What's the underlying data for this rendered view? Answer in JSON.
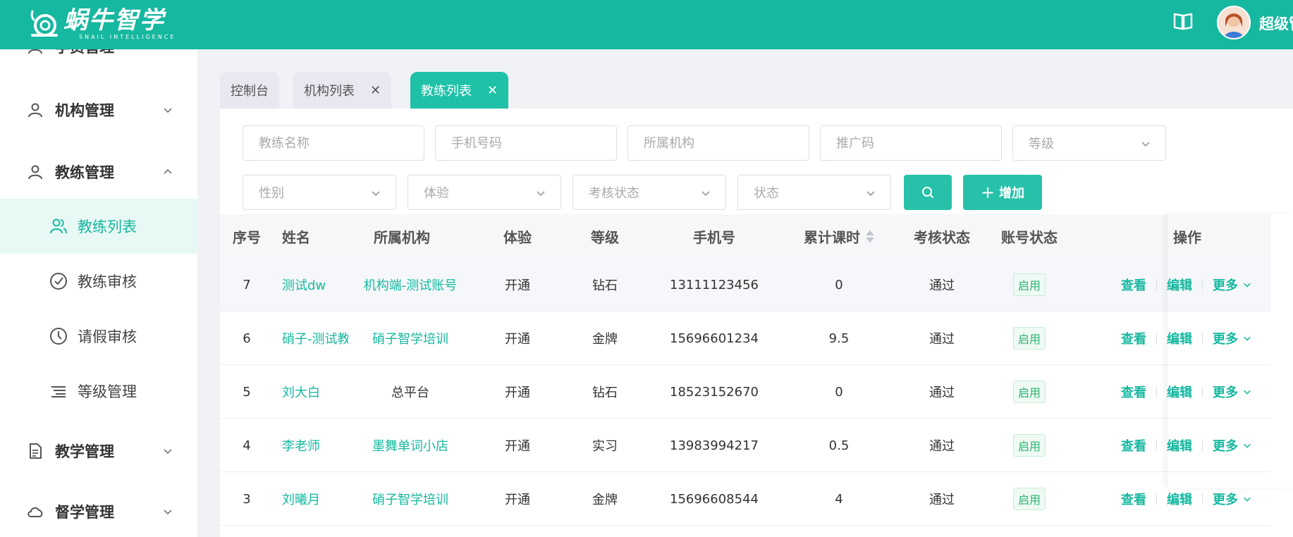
{
  "header": {
    "logo_cn": "蜗牛智学",
    "logo_en": "SNAIL INTELLIGENCE",
    "user_name": "超级管理员"
  },
  "sidebar": {
    "items": [
      {
        "label": "学员管理",
        "icon": "user-icon"
      },
      {
        "label": "机构管理",
        "icon": "user-icon"
      },
      {
        "label": "教练管理",
        "icon": "user-icon"
      },
      {
        "label": "教练列表",
        "icon": "users-icon"
      },
      {
        "label": "教练审核",
        "icon": "check-circle-icon"
      },
      {
        "label": "请假审核",
        "icon": "clock-icon"
      },
      {
        "label": "等级管理",
        "icon": "list-icon"
      },
      {
        "label": "教学管理",
        "icon": "document-icon"
      },
      {
        "label": "督学管理",
        "icon": "cloud-icon"
      }
    ]
  },
  "tabs": [
    {
      "label": "控制台"
    },
    {
      "label": "机构列表"
    },
    {
      "label": "教练列表"
    }
  ],
  "filters": {
    "coach_name": "教练名称",
    "phone": "手机号码",
    "org": "所属机构",
    "promo_code": "推广码",
    "level": "等级",
    "gender": "性别",
    "trial": "体验",
    "review_status": "考核状态",
    "status": "状态",
    "add_label": "增加"
  },
  "table": {
    "headers": {
      "index": "序号",
      "name": "姓名",
      "org": "所属机构",
      "trial": "体验",
      "level": "等级",
      "phone": "手机号",
      "hours": "累计课时",
      "review": "考核状态",
      "account": "账号状态",
      "ops": "操作"
    },
    "ops": {
      "view": "查看",
      "edit": "编辑",
      "more": "更多"
    },
    "rows": [
      {
        "index": "7",
        "name": "测试dw",
        "org": "机构端-测试账号",
        "trial": "开通",
        "level": "钻石",
        "phone": "13111123456",
        "hours": "0",
        "review": "通过",
        "account": "启用"
      },
      {
        "index": "6",
        "name": "硝子-测试教练",
        "org": "硝子智学培训",
        "trial": "开通",
        "level": "金牌",
        "phone": "15696601234",
        "hours": "9.5",
        "review": "通过",
        "account": "启用"
      },
      {
        "index": "5",
        "name": "刘大白",
        "org": "总平台",
        "trial": "开通",
        "level": "钻石",
        "phone": "18523152670",
        "hours": "0",
        "review": "通过",
        "account": "启用"
      },
      {
        "index": "4",
        "name": "李老师",
        "org": "墨舞单词小店",
        "trial": "开通",
        "level": "实习",
        "phone": "13983994217",
        "hours": "0.5",
        "review": "通过",
        "account": "启用"
      },
      {
        "index": "3",
        "name": "刘曦月",
        "org": "硝子智学培训",
        "trial": "开通",
        "level": "金牌",
        "phone": "15696608544",
        "hours": "4",
        "review": "通过",
        "account": "启用"
      }
    ]
  },
  "colors": {
    "primary": "#16b8a0",
    "badge_green": "#2bb371"
  }
}
